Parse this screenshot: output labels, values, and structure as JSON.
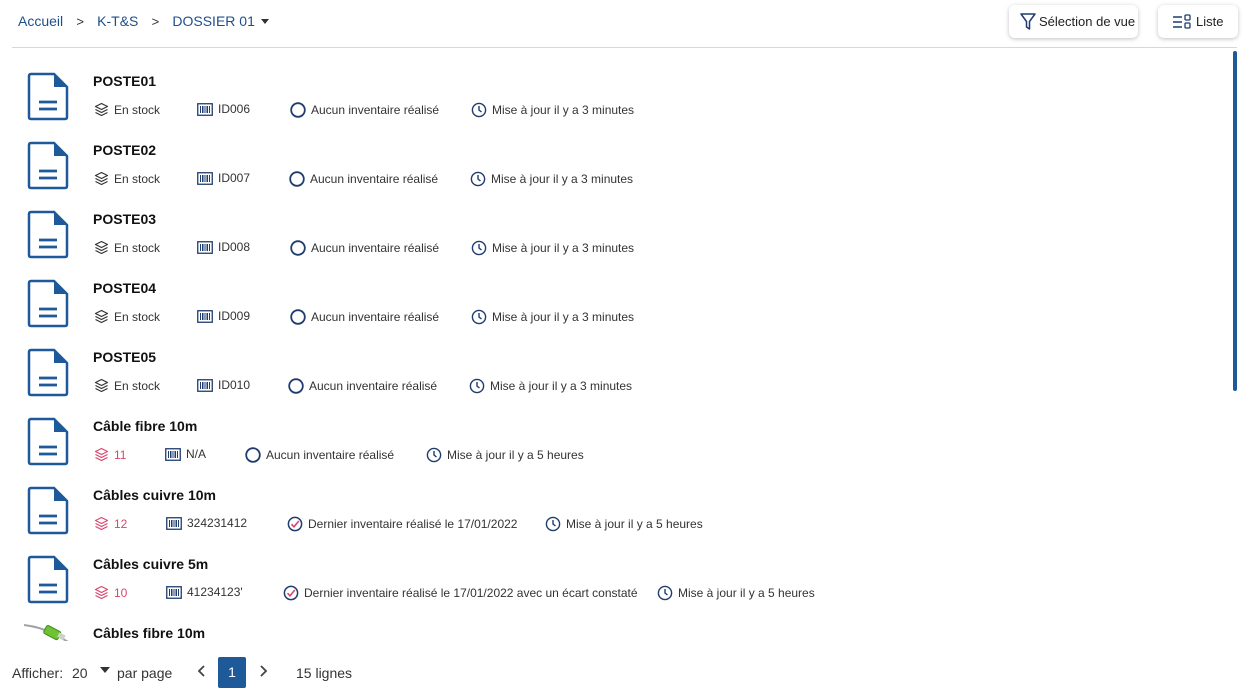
{
  "breadcrumb": {
    "home": "Accueil",
    "level1": "K-T&S",
    "level2": "DOSSIER 01"
  },
  "toolbar": {
    "view_selection_label": "Sélection de vue",
    "list_label": "Liste"
  },
  "items": [
    {
      "title": "POSTE01",
      "stock": "En stock",
      "id": "ID006",
      "inventory": "Aucun inventaire réalisé",
      "updated": "Mise à jour il y a 3 minutes"
    },
    {
      "title": "POSTE02",
      "stock": "En stock",
      "id": "ID007",
      "inventory": "Aucun inventaire réalisé",
      "updated": "Mise à jour il y a 3 minutes"
    },
    {
      "title": "POSTE03",
      "stock": "En stock",
      "id": "ID008",
      "inventory": "Aucun inventaire réalisé",
      "updated": "Mise à jour il y a 3 minutes"
    },
    {
      "title": "POSTE04",
      "stock": "En stock",
      "id": "ID009",
      "inventory": "Aucun inventaire réalisé",
      "updated": "Mise à jour il y a 3 minutes"
    },
    {
      "title": "POSTE05",
      "stock": "En stock",
      "id": "ID010",
      "inventory": "Aucun inventaire réalisé",
      "updated": "Mise à jour il y a 3 minutes"
    },
    {
      "title": "Câble fibre 10m",
      "stock": "11",
      "id": "N/A",
      "inventory": "Aucun inventaire réalisé",
      "updated": "Mise à jour il y a 5 heures"
    },
    {
      "title": "Câbles cuivre 10m",
      "stock": "12",
      "id": "324231412",
      "inventory": "Dernier inventaire réalisé le 17/01/2022",
      "updated": "Mise à jour il y a 5 heures"
    },
    {
      "title": "Câbles cuivre 5m",
      "stock": "10",
      "id": "41234123'",
      "inventory": "Dernier inventaire réalisé le 17/01/2022 avec un écart constaté",
      "updated": "Mise à jour il y a 5 heures"
    },
    {
      "title": "Câbles fibre 10m"
    }
  ],
  "pagination": {
    "show_label": "Afficher:",
    "per_page_value": "20",
    "per_page_label": "par page",
    "current_page": "1",
    "total": "15 lignes"
  },
  "colors": {
    "accent": "#1e5a99",
    "quantity": "#d9466e"
  }
}
